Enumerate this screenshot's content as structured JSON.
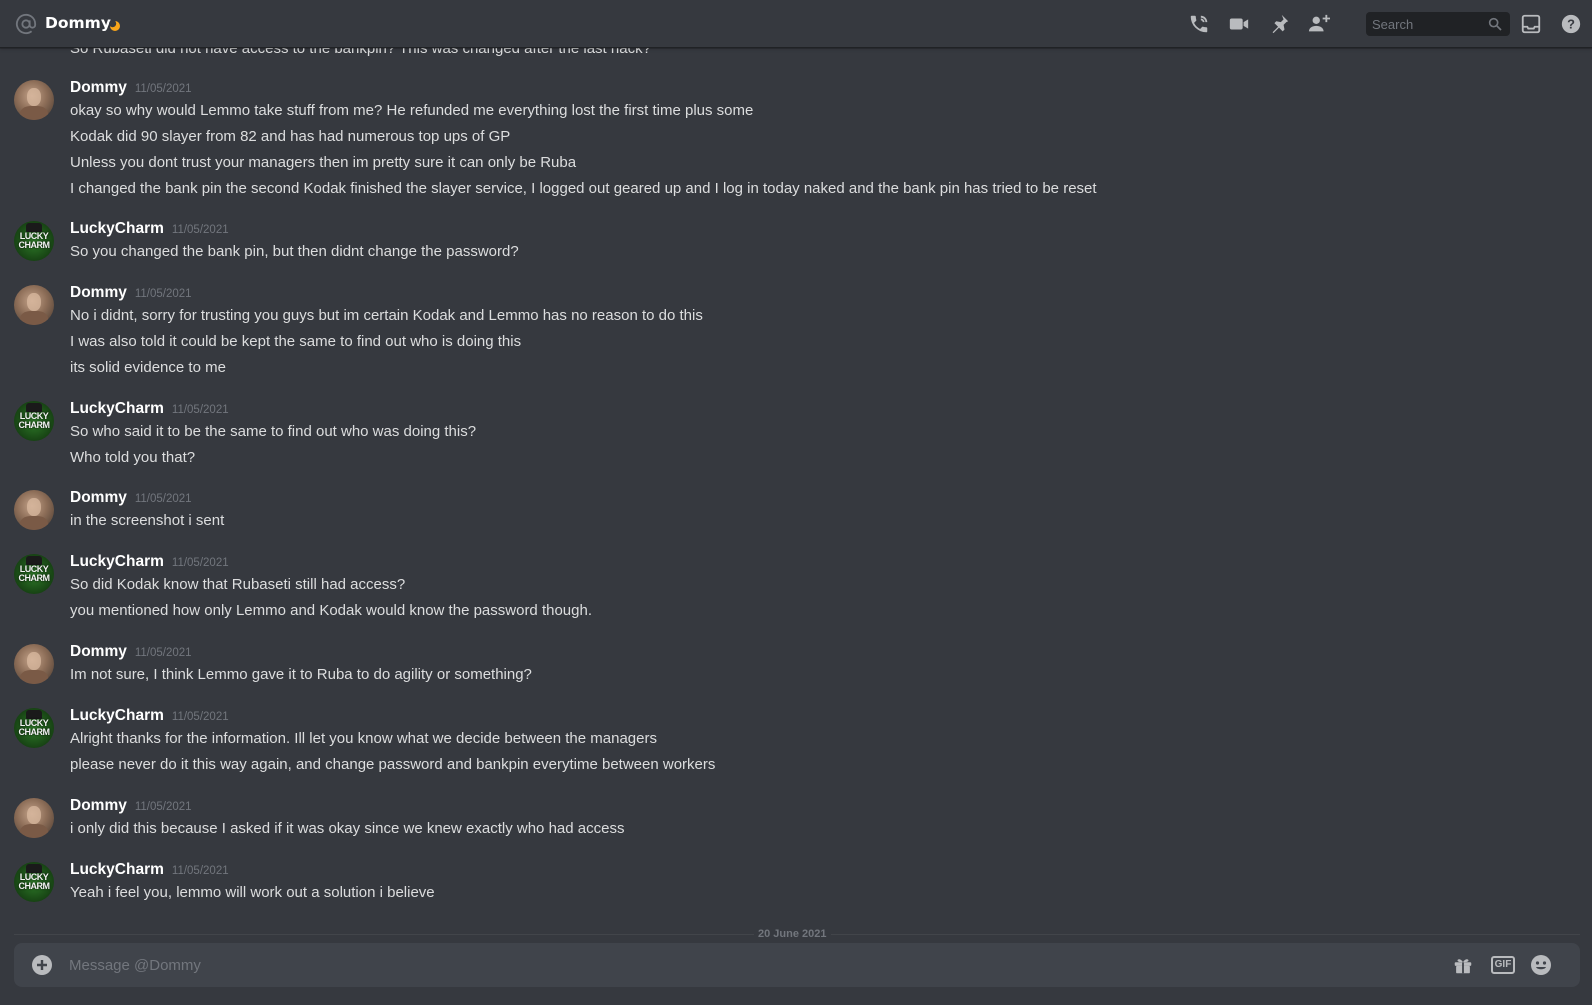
{
  "header": {
    "title": "Dommy",
    "icons": [
      "at-icon",
      "moon-status-icon",
      "phone-icon",
      "video-icon",
      "pin-icon",
      "add-friend-icon",
      "search-icon",
      "inbox-icon",
      "help-icon"
    ],
    "search_placeholder": "Search"
  },
  "partial_top_line": "So Rubaseti did not have access to the bankpin? This was changed after the last hack?",
  "messages": [
    {
      "author": "Dommy",
      "timestamp": "11/05/2021",
      "lines": [
        "okay so why would Lemmo take stuff from me? He refunded me everything lost the first time plus some",
        "Kodak did 90 slayer from 82 and has had numerous top ups of GP",
        "Unless you dont trust your managers then im pretty sure it can only be Ruba",
        "I changed the bank pin the second Kodak finished the slayer service, I logged out geared up and I log in today naked and the bank pin has tried to be reset"
      ]
    },
    {
      "author": "LuckyCharm",
      "timestamp": "11/05/2021",
      "lines": [
        "So you changed the bank pin, but then didnt change the password?"
      ]
    },
    {
      "author": "Dommy",
      "timestamp": "11/05/2021",
      "lines": [
        "No i didnt, sorry for trusting you guys but im certain Kodak and Lemmo has no reason to do this",
        "I was also told it could be kept the same to find out who is doing this",
        "its solid evidence to me"
      ]
    },
    {
      "author": "LuckyCharm",
      "timestamp": "11/05/2021",
      "lines": [
        "So who said it to be the same to find out who was doing this?",
        "Who told you that?"
      ]
    },
    {
      "author": "Dommy",
      "timestamp": "11/05/2021",
      "lines": [
        "in the screenshot i sent"
      ]
    },
    {
      "author": "LuckyCharm",
      "timestamp": "11/05/2021",
      "lines": [
        "So did Kodak know that Rubaseti still had access?",
        "you mentioned how only Lemmo and Kodak would know the password though."
      ]
    },
    {
      "author": "Dommy",
      "timestamp": "11/05/2021",
      "lines": [
        "Im not sure, I think Lemmo gave it to Ruba to do agility or something?"
      ]
    },
    {
      "author": "LuckyCharm",
      "timestamp": "11/05/2021",
      "lines": [
        "Alright thanks for the information. Ill let you know what we decide between the managers",
        "please never do it this way again, and change password and bankpin everytime between workers"
      ]
    },
    {
      "author": "Dommy",
      "timestamp": "11/05/2021",
      "lines": [
        "i only did this because I asked if it was okay since we knew exactly who had access"
      ]
    },
    {
      "author": "LuckyCharm",
      "timestamp": "11/05/2021",
      "lines": [
        "Yeah i feel you, lemmo will work out a solution i believe"
      ]
    }
  ],
  "avatar_text": {
    "lucky": "LUCKY CHARM"
  },
  "divider": {
    "label": "20 June 2021"
  },
  "composer": {
    "placeholder": "Message @Dommy",
    "gif_label": "GIF",
    "icons": [
      "plus-circle-icon",
      "gift-icon",
      "gif-icon",
      "emoji-icon"
    ]
  },
  "colors": {
    "background": "#36393f",
    "header_border": "#202225",
    "input_background": "#40444b",
    "author": "#ffffff",
    "text": "#dcddde",
    "muted": "#72767d",
    "status_moon": "#faa61a"
  }
}
